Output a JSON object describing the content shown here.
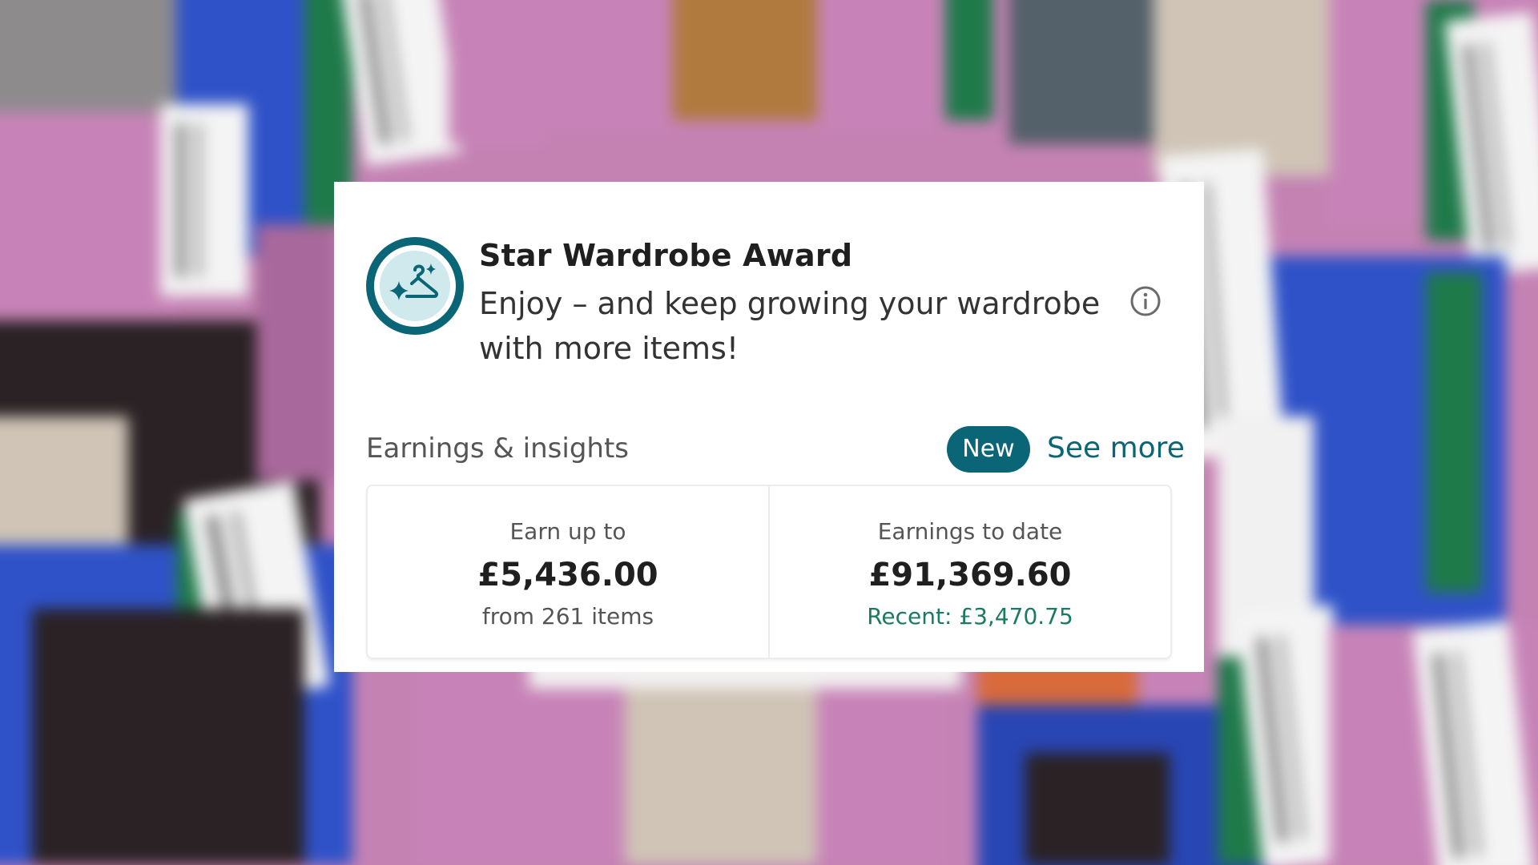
{
  "card": {
    "title": "Star Wardrobe Award",
    "subtitle": "Enjoy – and keep growing your wardrobe with more items!",
    "award_icon": "hanger-sparkle-icon",
    "info_icon": "info-icon"
  },
  "insights": {
    "section_label": "Earnings & insights",
    "badge": "New",
    "see_more": "See more",
    "stats": [
      {
        "label": "Earn up to",
        "value": "£5,436.00",
        "sub": "from 261 items"
      },
      {
        "label": "Earnings to date",
        "value": "£91,369.60",
        "sub": "Recent: £3,470.75"
      }
    ]
  },
  "colors": {
    "accent": "#0a6577",
    "positive": "#1a7a62"
  }
}
